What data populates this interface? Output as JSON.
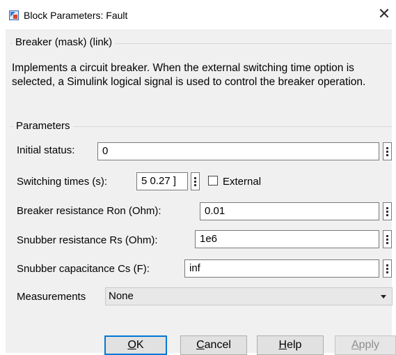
{
  "window": {
    "title": "Block Parameters: Fault",
    "icon": "simulink-block-icon",
    "close_icon": "close-icon"
  },
  "mask": {
    "title": "Breaker (mask) (link)",
    "description": "Implements a circuit breaker. When the external switching time option is selected, a Simulink logical signal is used to control the breaker operation."
  },
  "parameters": {
    "title": "Parameters",
    "initial_status": {
      "label": "Initial status:",
      "value": "0"
    },
    "switching_times": {
      "label": "Switching times (s):",
      "value": "5 0.27 ]",
      "external_label": "External",
      "external_checked": false
    },
    "breaker_resistance": {
      "label": "Breaker resistance Ron (Ohm):",
      "value": "0.01"
    },
    "snubber_resistance": {
      "label": "Snubber resistance Rs (Ohm):",
      "value": "1e6"
    },
    "snubber_capacitance": {
      "label": "Snubber capacitance Cs (F):",
      "value": "inf"
    },
    "measurements": {
      "label": "Measurements",
      "value": "None"
    }
  },
  "buttons": {
    "ok": {
      "accel": "O",
      "rest": "K"
    },
    "cancel": {
      "accel": "C",
      "rest": "ancel"
    },
    "help": {
      "accel": "H",
      "rest": "elp"
    },
    "apply": {
      "accel": "A",
      "rest": "pply"
    }
  }
}
